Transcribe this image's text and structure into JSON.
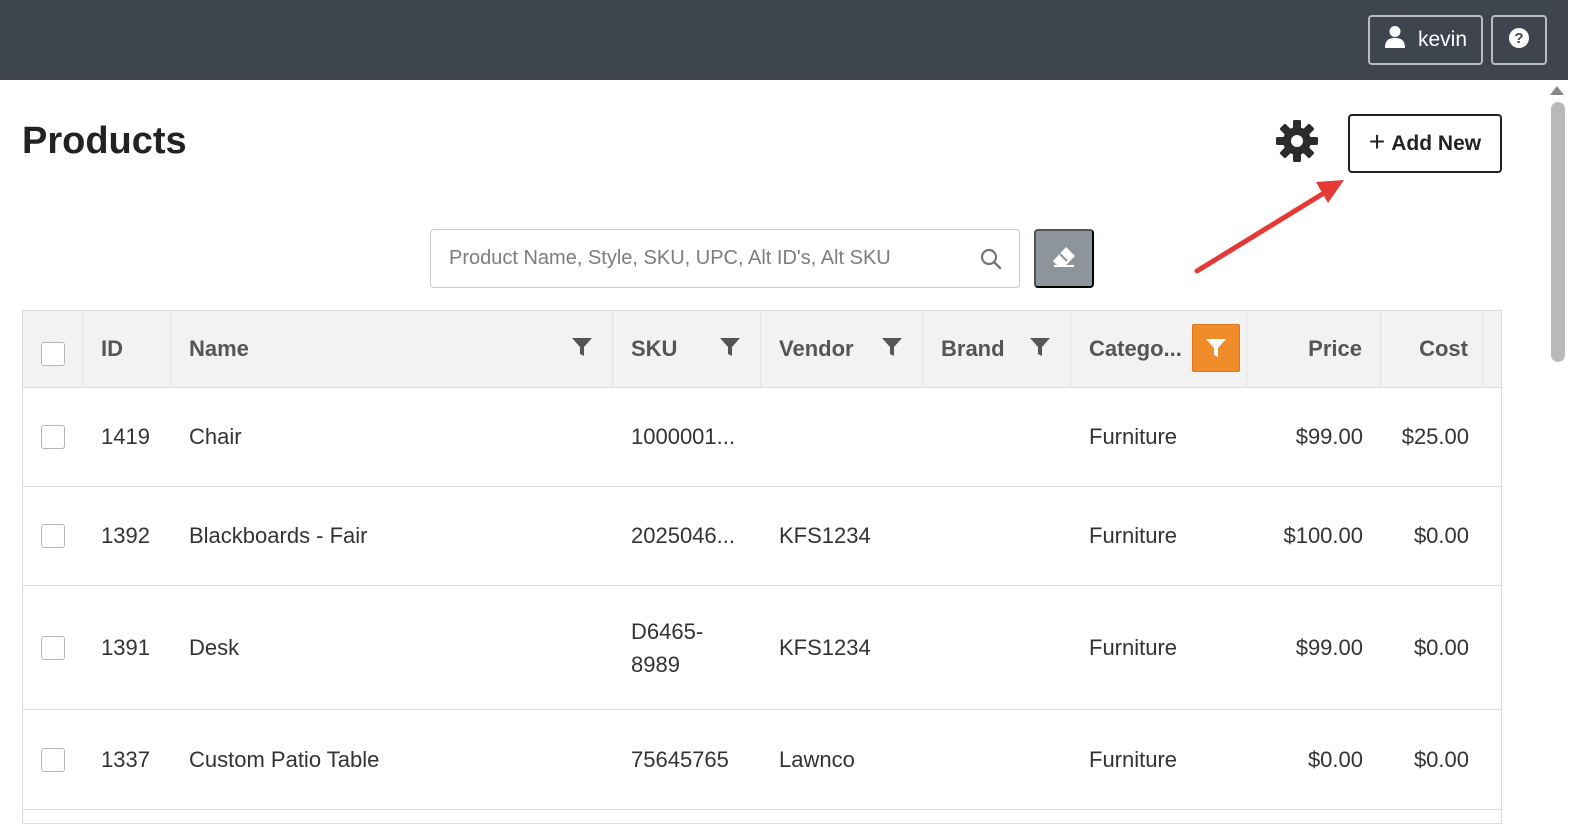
{
  "topbar": {
    "user_name": "kevin",
    "help_label": "?"
  },
  "page": {
    "title": "Products",
    "add_new_label": "Add New",
    "add_new_plus": "+"
  },
  "search": {
    "placeholder": "Product Name, Style, SKU, UPC, Alt ID's, Alt SKU",
    "value": ""
  },
  "colors": {
    "topbar": "#3f454e",
    "active_filter": "#f08d2a",
    "annotation_arrow": "#e53935",
    "clear_button": "#8d949b"
  },
  "icons": {
    "user": "user-icon",
    "help": "help-icon",
    "settings": "gear-icon",
    "search": "search-icon",
    "clear": "eraser-icon",
    "filter": "filter-icon"
  },
  "table": {
    "columns": [
      {
        "key": "id",
        "label": "ID"
      },
      {
        "key": "name",
        "label": "Name"
      },
      {
        "key": "sku",
        "label": "SKU"
      },
      {
        "key": "vendor",
        "label": "Vendor"
      },
      {
        "key": "brand",
        "label": "Brand"
      },
      {
        "key": "category",
        "label": "Catego..."
      },
      {
        "key": "price",
        "label": "Price"
      },
      {
        "key": "cost",
        "label": "Cost"
      }
    ],
    "rows": [
      {
        "id": "1419",
        "name": "Chair",
        "sku": "1000001...",
        "vendor": "",
        "brand": "",
        "category": "Furniture",
        "price": "$99.00",
        "cost": "$25.00"
      },
      {
        "id": "1392",
        "name": "Blackboards - Fair",
        "sku": "2025046...",
        "vendor": "KFS1234",
        "brand": "",
        "category": "Furniture",
        "price": "$100.00",
        "cost": "$0.00"
      },
      {
        "id": "1391",
        "name": "Desk",
        "sku": "D6465-\n8989",
        "vendor": "KFS1234",
        "brand": "",
        "category": "Furniture",
        "price": "$99.00",
        "cost": "$0.00"
      },
      {
        "id": "1337",
        "name": "Custom Patio Table",
        "sku": "75645765",
        "vendor": "Lawnco",
        "brand": "",
        "category": "Furniture",
        "price": "$0.00",
        "cost": "$0.00"
      }
    ]
  }
}
